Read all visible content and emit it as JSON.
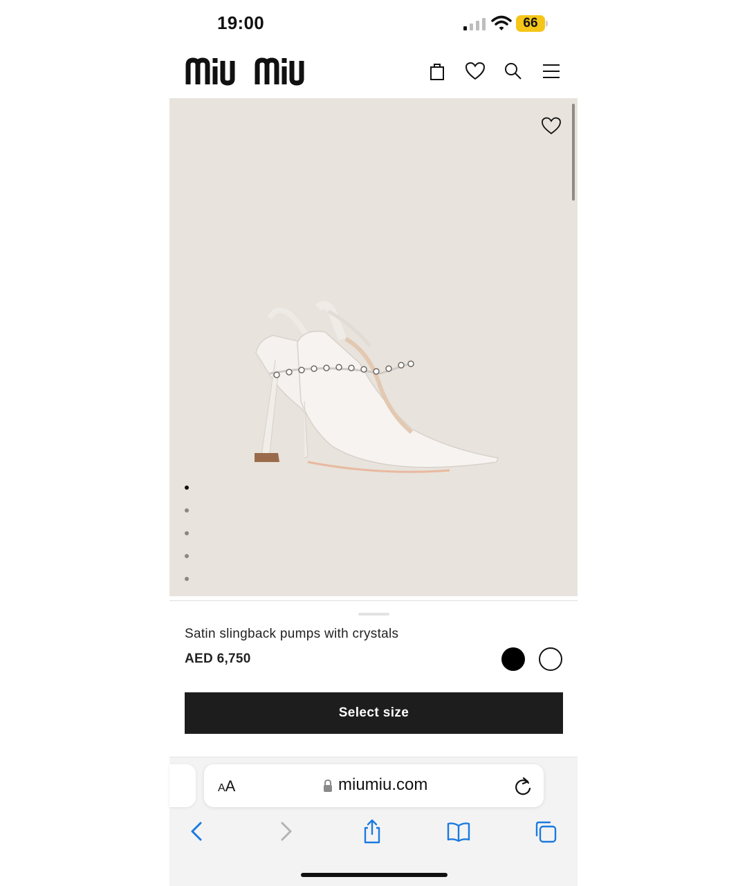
{
  "status_bar": {
    "time": "19:00",
    "battery": "66",
    "battery_color": "#f5c518"
  },
  "header": {
    "brand": "miu miu",
    "icons": [
      "shopping-bag-icon",
      "wishlist-heart-icon",
      "search-icon",
      "menu-icon"
    ]
  },
  "gallery": {
    "background": "#e8e3dc",
    "image_alt": "Satin slingback pumps with crystals",
    "dots": 5,
    "active_dot": 1
  },
  "product": {
    "name": "Satin slingback pumps with crystals",
    "price": "AED 6,750",
    "colors": [
      "black",
      "white"
    ],
    "cta_label": "Select size"
  },
  "browser": {
    "text_size_label": "AA",
    "url": "miumiu.com",
    "tint": "#1a7ae0"
  }
}
